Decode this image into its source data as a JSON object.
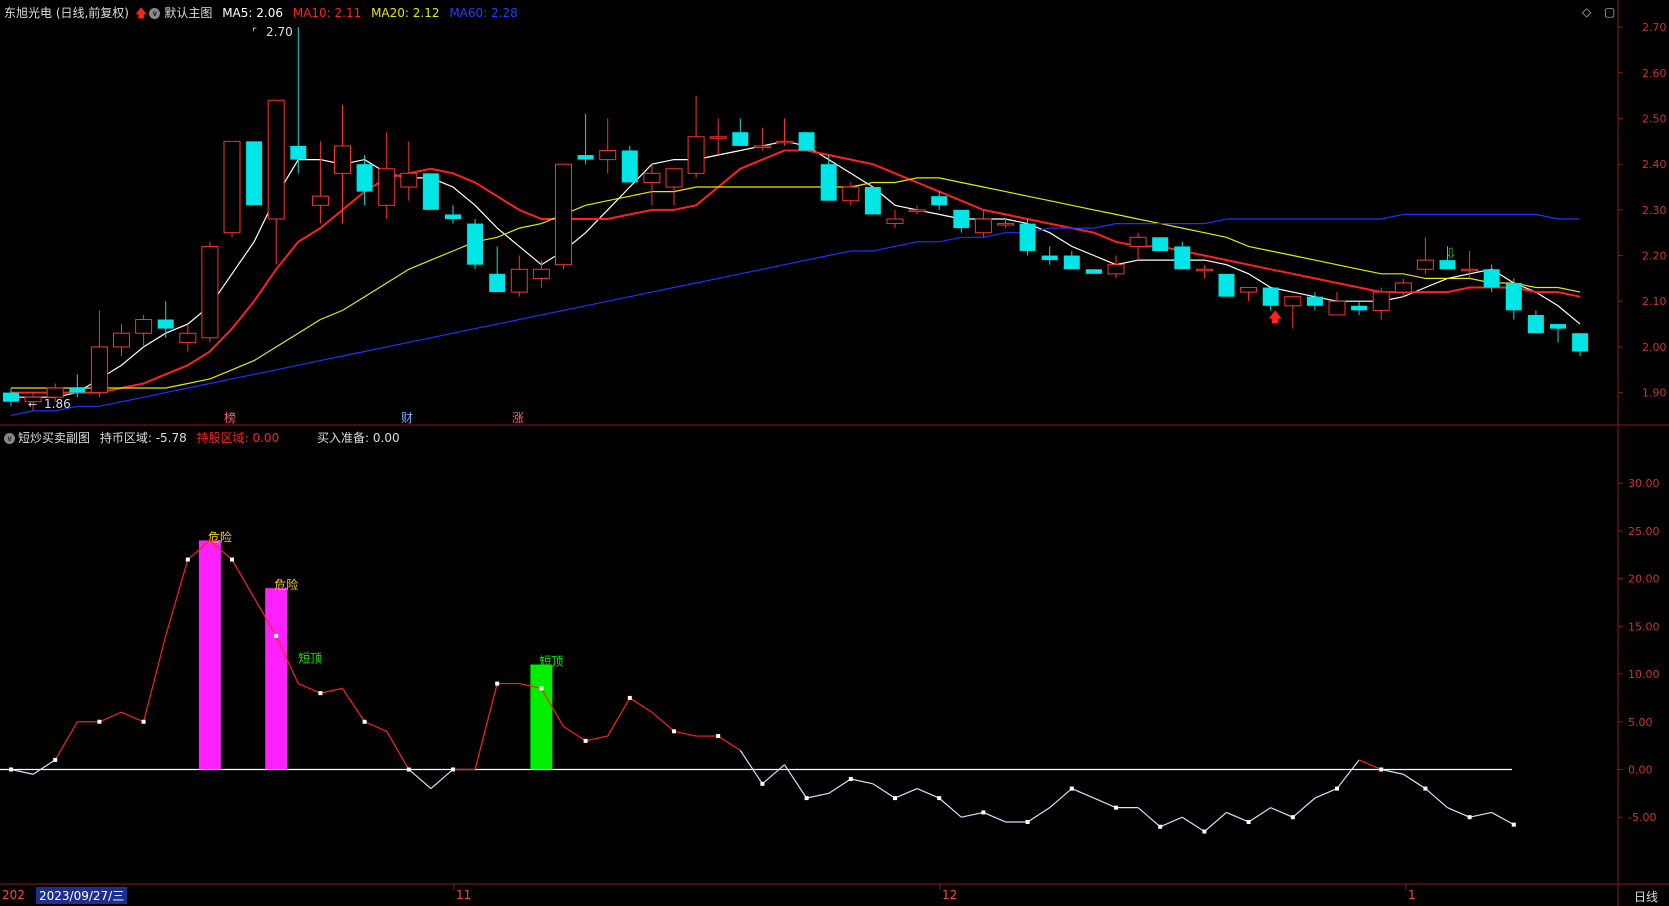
{
  "main_header": {
    "title": "东旭光电 (日线,前复权)",
    "template": "默认主图",
    "ma5_label": "MA5:",
    "ma5_value": "2.06",
    "ma10_label": "MA10:",
    "ma10_value": "2.11",
    "ma20_label": "MA20:",
    "ma20_value": "2.12",
    "ma60_label": "MA60:",
    "ma60_value": "2.28",
    "colors": {
      "ma5": "#ffffff",
      "ma10": "#ff2020",
      "ma20": "#e8e800",
      "ma60": "#2030ff"
    }
  },
  "sub_header": {
    "title": "短炒买卖副图",
    "hold_coin_label": "持币区域:",
    "hold_coin_value": "-5.78",
    "hold_stock_label": "持股区域:",
    "hold_stock_value": "0.00",
    "buy_prep_label": "买入准备:",
    "buy_prep_value": "0.00"
  },
  "markers": {
    "m1": "榜",
    "m2": "财",
    "m3": "涨"
  },
  "price_labels": {
    "high": "2.70",
    "low": "1.86"
  },
  "bottom": {
    "year_stub": "202",
    "cursor_date": "2023/09/27/三",
    "months": [
      "11",
      "12",
      "1"
    ],
    "period_button": "日线"
  },
  "chart_data": [
    {
      "type": "candlestick",
      "title": "东旭光电 (日线,前复权)",
      "y_ticks": [
        "2.70",
        "2.60",
        "2.50",
        "2.40",
        "2.30",
        "2.20",
        "2.10",
        "2.00",
        "1.90"
      ],
      "ylim": [
        1.84,
        2.72
      ],
      "ohlc": [
        [
          1.9,
          1.91,
          1.87,
          1.88
        ],
        [
          1.88,
          1.9,
          1.86,
          1.89
        ],
        [
          1.89,
          1.92,
          1.88,
          1.91
        ],
        [
          1.91,
          1.94,
          1.89,
          1.9
        ],
        [
          1.9,
          2.08,
          1.89,
          2.0
        ],
        [
          2.0,
          2.05,
          1.98,
          2.03
        ],
        [
          2.03,
          2.07,
          2.0,
          2.06
        ],
        [
          2.06,
          2.1,
          2.02,
          2.04
        ],
        [
          2.01,
          2.05,
          1.99,
          2.03
        ],
        [
          2.02,
          2.23,
          2.01,
          2.22
        ],
        [
          2.25,
          2.45,
          2.24,
          2.45
        ],
        [
          2.45,
          2.45,
          2.31,
          2.31
        ],
        [
          2.28,
          2.54,
          2.18,
          2.54
        ],
        [
          2.44,
          2.7,
          2.38,
          2.41
        ],
        [
          2.31,
          2.45,
          2.27,
          2.33
        ],
        [
          2.38,
          2.53,
          2.27,
          2.44
        ],
        [
          2.4,
          2.42,
          2.31,
          2.34
        ],
        [
          2.31,
          2.47,
          2.28,
          2.39
        ],
        [
          2.35,
          2.45,
          2.32,
          2.38
        ],
        [
          2.38,
          2.38,
          2.3,
          2.3
        ],
        [
          2.29,
          2.31,
          2.27,
          2.28
        ],
        [
          2.27,
          2.28,
          2.17,
          2.18
        ],
        [
          2.16,
          2.22,
          2.13,
          2.12
        ],
        [
          2.12,
          2.2,
          2.11,
          2.17
        ],
        [
          2.15,
          2.19,
          2.13,
          2.17
        ],
        [
          2.18,
          2.4,
          2.17,
          2.4
        ],
        [
          2.42,
          2.51,
          2.4,
          2.41
        ],
        [
          2.41,
          2.5,
          2.38,
          2.43
        ],
        [
          2.43,
          2.44,
          2.36,
          2.36
        ],
        [
          2.36,
          2.4,
          2.31,
          2.38
        ],
        [
          2.35,
          2.39,
          2.31,
          2.39
        ],
        [
          2.38,
          2.55,
          2.37,
          2.46
        ],
        [
          2.46,
          2.5,
          2.42,
          2.46
        ],
        [
          2.47,
          2.5,
          2.44,
          2.44
        ],
        [
          2.44,
          2.48,
          2.43,
          2.44
        ],
        [
          2.45,
          2.5,
          2.44,
          2.45
        ],
        [
          2.47,
          2.47,
          2.43,
          2.43
        ],
        [
          2.4,
          2.42,
          2.32,
          2.32
        ],
        [
          2.32,
          2.36,
          2.31,
          2.35
        ],
        [
          2.35,
          2.35,
          2.29,
          2.29
        ],
        [
          2.27,
          2.3,
          2.26,
          2.28
        ],
        [
          2.3,
          2.31,
          2.29,
          2.3
        ],
        [
          2.33,
          2.34,
          2.3,
          2.31
        ],
        [
          2.3,
          2.3,
          2.25,
          2.26
        ],
        [
          2.25,
          2.3,
          2.24,
          2.28
        ],
        [
          2.27,
          2.28,
          2.26,
          2.27
        ],
        [
          2.27,
          2.28,
          2.2,
          2.21
        ],
        [
          2.2,
          2.22,
          2.18,
          2.19
        ],
        [
          2.2,
          2.21,
          2.17,
          2.17
        ],
        [
          2.17,
          2.17,
          2.16,
          2.16
        ],
        [
          2.16,
          2.2,
          2.15,
          2.18
        ],
        [
          2.22,
          2.25,
          2.19,
          2.24
        ],
        [
          2.24,
          2.24,
          2.21,
          2.21
        ],
        [
          2.22,
          2.23,
          2.17,
          2.17
        ],
        [
          2.17,
          2.18,
          2.15,
          2.17
        ],
        [
          2.16,
          2.16,
          2.11,
          2.11
        ],
        [
          2.12,
          2.13,
          2.1,
          2.13
        ],
        [
          2.13,
          2.13,
          2.08,
          2.09
        ],
        [
          2.09,
          2.11,
          2.04,
          2.11
        ],
        [
          2.11,
          2.12,
          2.08,
          2.09
        ],
        [
          2.07,
          2.12,
          2.07,
          2.1
        ],
        [
          2.09,
          2.1,
          2.07,
          2.08
        ],
        [
          2.08,
          2.13,
          2.06,
          2.12
        ],
        [
          2.12,
          2.15,
          2.11,
          2.14
        ],
        [
          2.17,
          2.24,
          2.16,
          2.19
        ],
        [
          2.19,
          2.22,
          2.17,
          2.17
        ],
        [
          2.17,
          2.21,
          2.15,
          2.17
        ],
        [
          2.17,
          2.18,
          2.12,
          2.13
        ],
        [
          2.14,
          2.15,
          2.06,
          2.08
        ],
        [
          2.07,
          2.08,
          2.03,
          2.03
        ],
        [
          2.05,
          2.05,
          2.01,
          2.04
        ],
        [
          2.03,
          2.03,
          1.98,
          1.99
        ]
      ],
      "ma_series": [
        {
          "name": "MA5",
          "color": "#ffffff",
          "values": [
            1.89,
            1.89,
            1.89,
            1.9,
            1.93,
            1.96,
            2.0,
            2.03,
            2.05,
            2.09,
            2.16,
            2.23,
            2.33,
            2.41,
            2.41,
            2.4,
            2.41,
            2.38,
            2.37,
            2.37,
            2.35,
            2.31,
            2.26,
            2.22,
            2.18,
            2.21,
            2.25,
            2.3,
            2.35,
            2.4,
            2.41,
            2.41,
            2.42,
            2.43,
            2.44,
            2.45,
            2.44,
            2.41,
            2.38,
            2.35,
            2.31,
            2.3,
            2.29,
            2.28,
            2.28,
            2.28,
            2.27,
            2.25,
            2.22,
            2.2,
            2.18,
            2.19,
            2.19,
            2.19,
            2.19,
            2.18,
            2.16,
            2.13,
            2.12,
            2.11,
            2.1,
            2.1,
            2.1,
            2.11,
            2.13,
            2.15,
            2.16,
            2.17,
            2.14,
            2.12,
            2.09,
            2.05
          ]
        },
        {
          "name": "MA10",
          "color": "#ff2020",
          "values": [
            1.9,
            1.9,
            1.9,
            1.9,
            1.9,
            1.91,
            1.92,
            1.94,
            1.96,
            1.99,
            2.04,
            2.1,
            2.17,
            2.23,
            2.26,
            2.3,
            2.34,
            2.37,
            2.38,
            2.39,
            2.38,
            2.36,
            2.33,
            2.3,
            2.28,
            2.28,
            2.28,
            2.28,
            2.29,
            2.3,
            2.3,
            2.31,
            2.35,
            2.39,
            2.41,
            2.43,
            2.43,
            2.42,
            2.41,
            2.4,
            2.38,
            2.36,
            2.34,
            2.32,
            2.3,
            2.29,
            2.28,
            2.27,
            2.26,
            2.25,
            2.23,
            2.22,
            2.22,
            2.21,
            2.2,
            2.19,
            2.18,
            2.17,
            2.16,
            2.15,
            2.14,
            2.13,
            2.12,
            2.12,
            2.12,
            2.12,
            2.13,
            2.13,
            2.13,
            2.12,
            2.12,
            2.11
          ]
        },
        {
          "name": "MA20",
          "color": "#e8e800",
          "values": [
            1.91,
            1.91,
            1.91,
            1.91,
            1.91,
            1.91,
            1.91,
            1.91,
            1.92,
            1.93,
            1.95,
            1.97,
            2.0,
            2.03,
            2.06,
            2.08,
            2.11,
            2.14,
            2.17,
            2.19,
            2.21,
            2.23,
            2.24,
            2.26,
            2.27,
            2.29,
            2.31,
            2.32,
            2.33,
            2.34,
            2.34,
            2.35,
            2.35,
            2.35,
            2.35,
            2.35,
            2.35,
            2.35,
            2.35,
            2.36,
            2.36,
            2.37,
            2.37,
            2.36,
            2.35,
            2.34,
            2.33,
            2.32,
            2.31,
            2.3,
            2.29,
            2.28,
            2.27,
            2.26,
            2.25,
            2.24,
            2.22,
            2.21,
            2.2,
            2.19,
            2.18,
            2.17,
            2.16,
            2.16,
            2.15,
            2.15,
            2.15,
            2.14,
            2.14,
            2.13,
            2.13,
            2.12
          ]
        },
        {
          "name": "MA60",
          "color": "#2030ff",
          "values": [
            1.85,
            1.86,
            1.86,
            1.87,
            1.87,
            1.88,
            1.89,
            1.9,
            1.91,
            1.92,
            1.93,
            1.94,
            1.95,
            1.96,
            1.97,
            1.98,
            1.99,
            2.0,
            2.01,
            2.02,
            2.03,
            2.04,
            2.05,
            2.06,
            2.07,
            2.08,
            2.09,
            2.1,
            2.11,
            2.12,
            2.13,
            2.14,
            2.15,
            2.16,
            2.17,
            2.18,
            2.19,
            2.2,
            2.21,
            2.21,
            2.22,
            2.23,
            2.23,
            2.24,
            2.24,
            2.25,
            2.25,
            2.26,
            2.26,
            2.26,
            2.27,
            2.27,
            2.27,
            2.27,
            2.27,
            2.28,
            2.28,
            2.28,
            2.28,
            2.28,
            2.28,
            2.28,
            2.28,
            2.29,
            2.29,
            2.29,
            2.29,
            2.29,
            2.29,
            2.29,
            2.28,
            2.28
          ]
        }
      ]
    },
    {
      "type": "line",
      "title": "短炒买卖副图",
      "y_ticks": [
        "30.00",
        "25.00",
        "20.00",
        "15.00",
        "10.00",
        "5.00",
        "0.00",
        "-5.00"
      ],
      "ylim": [
        -12,
        34
      ],
      "values": [
        0,
        -0.5,
        1,
        5,
        5,
        6,
        5,
        14,
        22,
        24,
        22,
        18,
        14,
        9,
        8,
        8.5,
        5,
        4,
        0,
        -2,
        0,
        0,
        9,
        9,
        8.5,
        4.5,
        3,
        3.5,
        7.5,
        6,
        4,
        3.5,
        3.5,
        2,
        -1.5,
        0.5,
        -3,
        -2.5,
        -1,
        -1.5,
        -3,
        -2,
        -3,
        -5,
        -4.5,
        -5.5,
        -5.5,
        -4,
        -2,
        -3,
        -4,
        -4,
        -6,
        -5,
        -6.5,
        -4.5,
        -5.5,
        -4,
        -5,
        -3,
        -2,
        1,
        0,
        -0.5,
        -2,
        -4,
        -5,
        -4.5,
        -5.78
      ],
      "bars": [
        {
          "index": 9,
          "value": 24,
          "color": "#ff20ff",
          "label": "危险"
        },
        {
          "index": 12,
          "value": 19,
          "color": "#ff20ff",
          "label": "危险"
        },
        {
          "index": 24,
          "value": 11,
          "color": "#00ee00",
          "label": "短顶"
        }
      ],
      "extra_labels": [
        {
          "index": 13,
          "value": 11,
          "text": "短顶",
          "color": "#00ee00"
        }
      ]
    }
  ]
}
